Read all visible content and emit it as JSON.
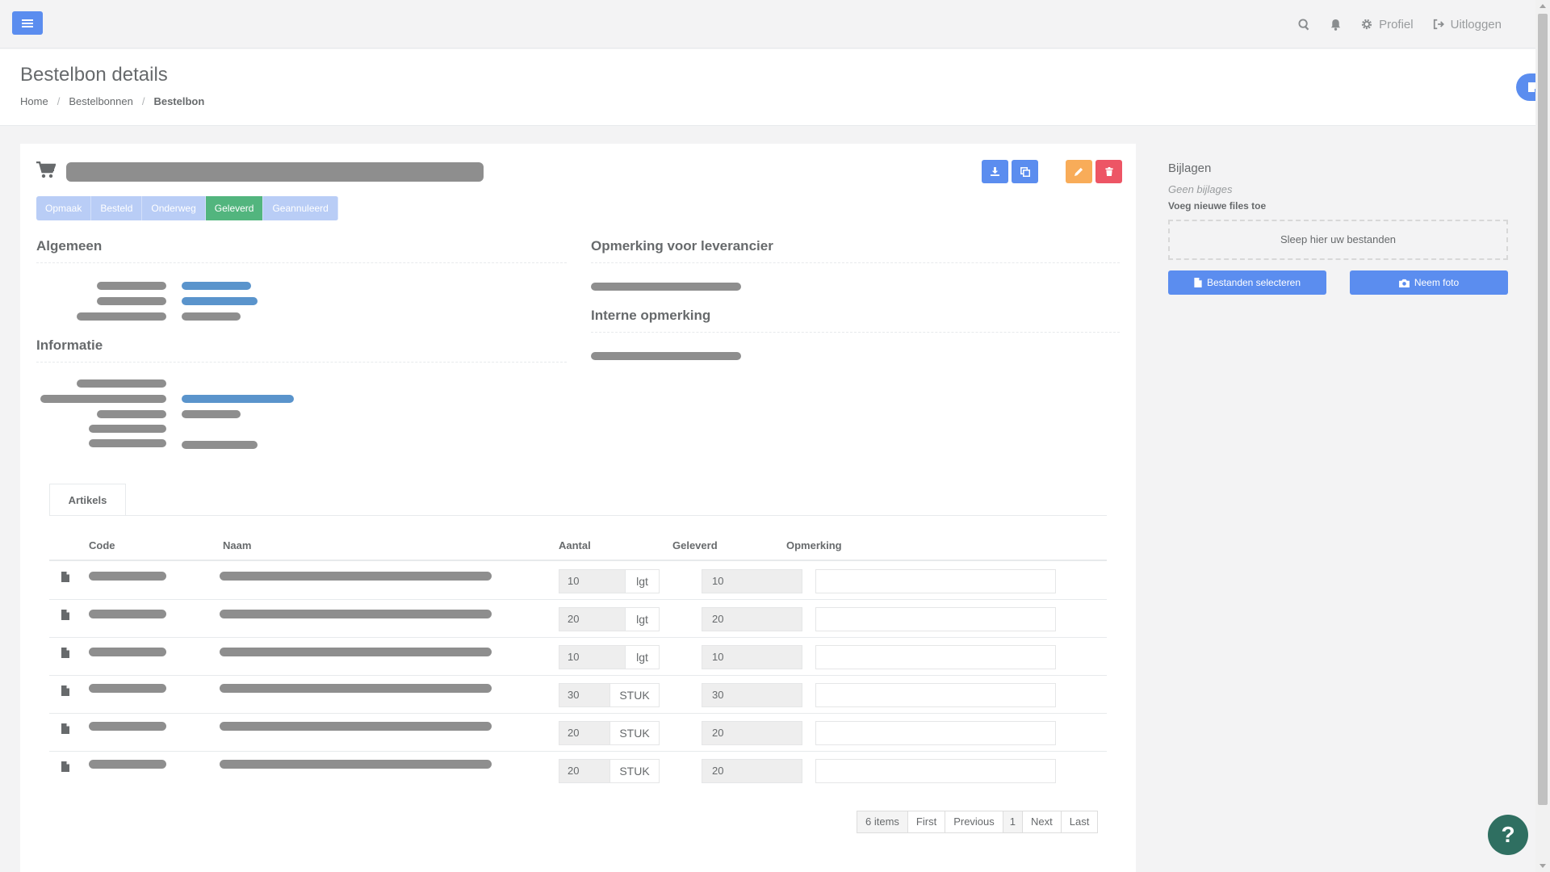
{
  "header": {
    "nav": {
      "profile_label": "Profiel",
      "logout_label": "Uitloggen"
    }
  },
  "page": {
    "title": "Bestelbon details",
    "breadcrumb": [
      "Home",
      "Bestelbonnen",
      "Bestelbon"
    ]
  },
  "order": {
    "statuses": [
      {
        "label": "Opmaak",
        "current": false
      },
      {
        "label": "Besteld",
        "current": false
      },
      {
        "label": "Onderweg",
        "current": false
      },
      {
        "label": "Geleverd",
        "current": true
      },
      {
        "label": "Geannuleerd",
        "current": false
      }
    ],
    "sections": {
      "general": "Algemeen",
      "info": "Informatie",
      "supplier_note": "Opmerking voor leverancier",
      "internal_note": "Interne opmerking"
    }
  },
  "tabs": {
    "articles": "Artikels"
  },
  "table": {
    "headers": {
      "code": "Code",
      "name": "Naam",
      "qty": "Aantal",
      "delivered": "Geleverd",
      "note": "Opmerking"
    },
    "rows": [
      {
        "qty": "10",
        "unit": "lgt",
        "delivered": "10"
      },
      {
        "qty": "20",
        "unit": "lgt",
        "delivered": "20"
      },
      {
        "qty": "10",
        "unit": "lgt",
        "delivered": "10"
      },
      {
        "qty": "30",
        "unit": "STUK",
        "delivered": "30"
      },
      {
        "qty": "20",
        "unit": "STUK",
        "delivered": "20"
      },
      {
        "qty": "20",
        "unit": "STUK",
        "delivered": "20"
      }
    ]
  },
  "pager": {
    "info": "6 items",
    "first": "First",
    "previous": "Previous",
    "page": "1",
    "next": "Next",
    "last": "Last"
  },
  "attachments": {
    "title": "Bijlagen",
    "none": "Geen bijlages",
    "add": "Voeg nieuwe files toe",
    "dropzone": "Sleep hier uw bestanden",
    "select_label": "Bestanden selecteren",
    "photo_label": "Neem foto"
  },
  "help": {
    "label": "?"
  },
  "colors": {
    "primary": "#5b8def",
    "success": "#52b57e",
    "warning": "#f8ac59",
    "danger": "#ed5565"
  }
}
